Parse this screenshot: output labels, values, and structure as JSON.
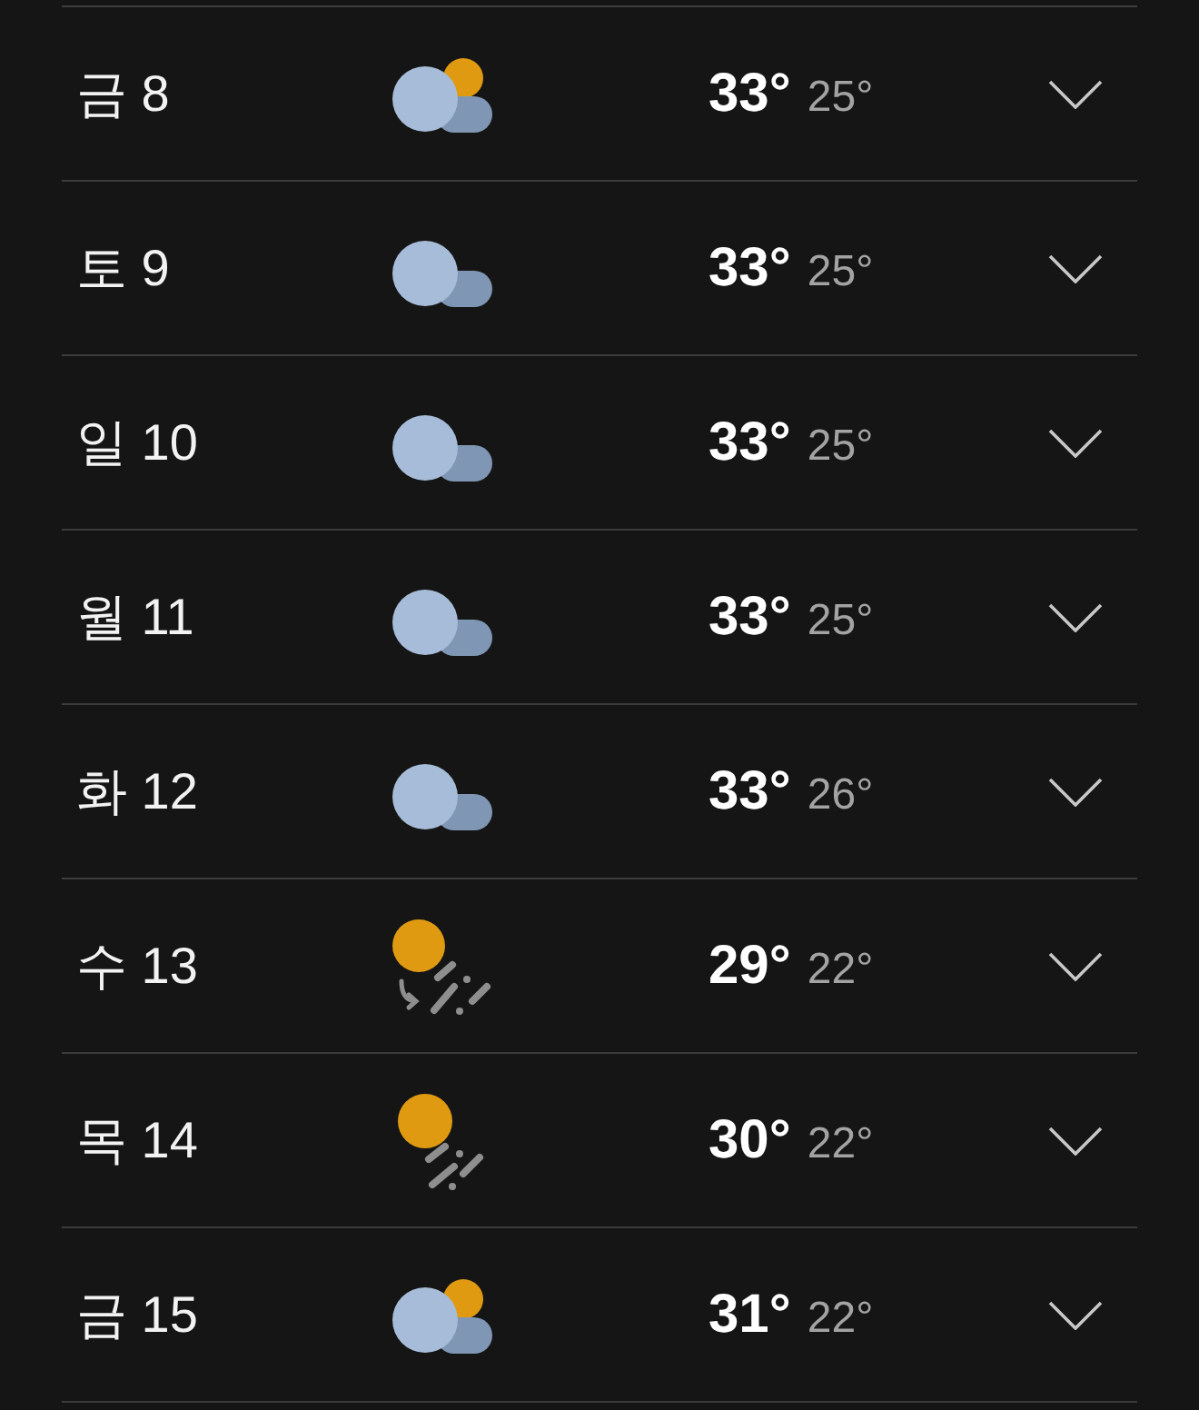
{
  "days": [
    {
      "day": "금 8",
      "kind": "cloud-sun",
      "high": "33°",
      "low": "25°",
      "expanded": false
    },
    {
      "day": "토 9",
      "kind": "cloud",
      "high": "33°",
      "low": "25°",
      "expanded": false
    },
    {
      "day": "일 10",
      "kind": "cloud",
      "high": "33°",
      "low": "25°",
      "expanded": false
    },
    {
      "day": "월 11",
      "kind": "cloud",
      "high": "33°",
      "low": "25°",
      "expanded": false
    },
    {
      "day": "화 12",
      "kind": "cloud",
      "high": "33°",
      "low": "26°",
      "expanded": false
    },
    {
      "day": "수 13",
      "kind": "sun-rain-shift",
      "high": "29°",
      "low": "22°",
      "expanded": false
    },
    {
      "day": "목 14",
      "kind": "sun-rain",
      "high": "30°",
      "low": "22°",
      "expanded": false
    },
    {
      "day": "금 15",
      "kind": "cloud-sun",
      "high": "31°",
      "low": "22°",
      "expanded": false
    }
  ]
}
